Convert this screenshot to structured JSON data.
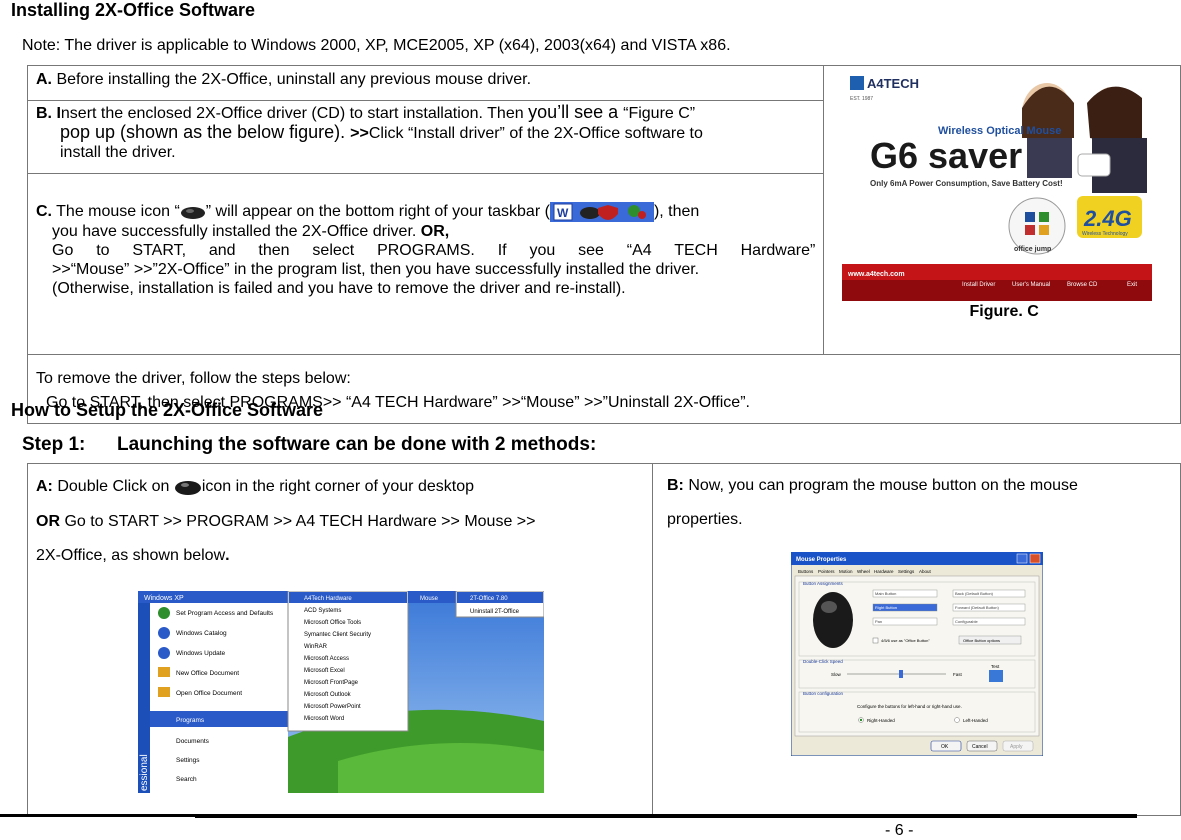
{
  "title": "Installing 2X-Office Software",
  "note": "Note: The driver is applicable to Windows 2000, XP, MCE2005, XP (x64), 2003(x64) and VISTA x86.",
  "install": {
    "a_label": "A.",
    "a_text": " Before installing the 2X-Office, uninstall any previous mouse driver.",
    "b_label": "B. I",
    "b_text1": "nsert the enclosed 2X-Office driver (CD) to start installation. Then ",
    "b_text2": "you’ll see a ",
    "b_text3": "“Figure C”",
    "b_text4": "pop up (shown as the below figure). ",
    "b_text5": ">>",
    "b_text6": "Click “Install driver” of the 2X-Office software to",
    "b_text7": "install the driver.",
    "c_label": "C.",
    "c_text1": " The mouse icon “",
    "c_text2": "” will appear on the bottom right of your taskbar (",
    "c_text3": "), then",
    "c_text4": "you have successfully installed the 2X-Office driver. ",
    "c_or": "OR,",
    "c_text5": "Go to START, and then select PROGRAMS. If you see “A4 TECH Hardware”",
    "c_text6": ">>“Mouse” >>”2X-Office” in the program list, then you have successfully installed the driver.",
    "c_text7": "(Otherwise, installation is failed and you have to remove the driver and re-install).",
    "figure_caption": "Figure. C",
    "remove1": "To remove the driver, follow the steps below:",
    "remove2": "Go to START, then select PROGRAMS>> “A4 TECH Hardware” >>“Mouse” >>”Uninstall 2X-Office”."
  },
  "banner": {
    "brand": "A4TECH",
    "small": "EST. 1987",
    "product_line": "Wireless Optical Mouse",
    "product": "G6 saver",
    "tagline": "Only 6mA Power Consumption, Save Battery Cost!",
    "badge": "2.4G",
    "badge_sub": "Wireless Technology",
    "office": "office jump",
    "url": "www.a4tech.com",
    "buttons": [
      "Install Driver",
      "User's Manual",
      "Browse CD",
      "Exit"
    ]
  },
  "setup_title": "How to Setup the 2X-Office Software",
  "step": {
    "label": "Step 1:",
    "text": "Launching the software can be done with 2 methods:"
  },
  "method_a": {
    "label": "A:",
    "text1": " Double Click on ",
    "text2": "icon in the right corner of your desktop",
    "or": "OR",
    "text3": " Go to START >> PROGRAM >> A4 TECH Hardware >> Mouse >>",
    "text4": "2X-Office, as shown below",
    "dot": "."
  },
  "method_b": {
    "label": "B:",
    "text1": " Now, you can program the mouse button on the mouse",
    "text2": "properties."
  },
  "startmenu": {
    "left_items": [
      "Set Program Access and Defaults",
      "Windows Catalog",
      "Windows Update",
      "New Office Document",
      "Open Office Document",
      "Programs",
      "Documents",
      "Settings",
      "Search"
    ],
    "programs": [
      "A4Tech Hardware",
      "ACD Systems",
      "Microsoft Office Tools",
      "Symantec Client Security",
      "WinRAR",
      "Microsoft Access",
      "Microsoft Excel",
      "Microsoft FrontPage",
      "Microsoft Outlook",
      "Microsoft PowerPoint",
      "Microsoft Word"
    ],
    "sub1": "Mouse",
    "sub2a": "2T-Office 7.80",
    "sub2b": "Uninstall 2T-Office",
    "vertical": "essional",
    "header": "Windows XP"
  },
  "mouseprops": {
    "title": "Mouse Properties",
    "tabs": [
      "Buttons",
      "Pointers",
      "Motion",
      "Wheel",
      "Hardware",
      "Settings",
      "About"
    ],
    "assign": "Button Assignments",
    "rows_left": [
      "Main Button",
      "Right Button",
      "Pan"
    ],
    "rows_right": [
      "Back (Default Button)",
      "Forward (Default Button)",
      "Configurable"
    ],
    "chk": "4/5/6 use as \"Office Button\"",
    "opt_btn": "Office Button options",
    "dbl": "Double-Click Speed",
    "slow": "Slow",
    "fast": "Fast",
    "test": "Test",
    "btncfg": "Button configuration",
    "cfgtext": "Configure the buttons for left-hand or right-hand use.",
    "right": "Right-Handed",
    "left": "Left-Handed",
    "ok": "OK",
    "cancel": "Cancel",
    "apply": "Apply"
  },
  "page_number": "- 6 -"
}
